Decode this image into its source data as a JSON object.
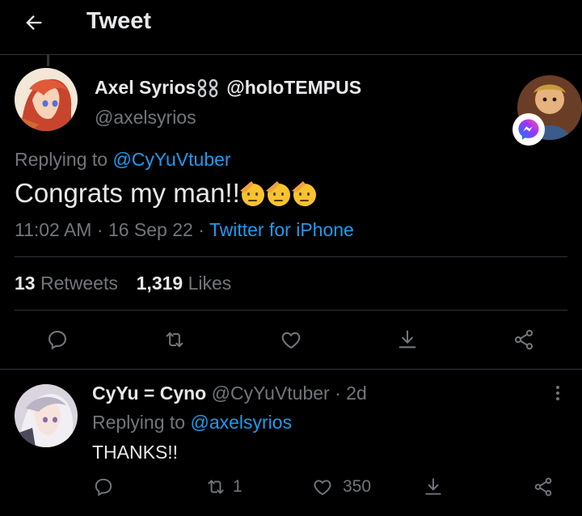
{
  "header": {
    "title": "Tweet",
    "back_icon": "arrow-left-icon"
  },
  "main_tweet": {
    "display_name": "Axel Syrios",
    "name_suffix_emoji": "chain-link-emoji",
    "secondary_handle": "@holoTEMPUS",
    "handle": "@axelsyrios",
    "replying_prefix": "Replying to",
    "replying_to": "@CyYuVtuber",
    "text": "Congrats my man!!",
    "emoji": [
      "saluting-face-emoji",
      "saluting-face-emoji",
      "saluting-face-emoji"
    ],
    "time": "11:02 AM",
    "sep": "·",
    "date": "16 Sep 22",
    "source": "Twitter for iPhone",
    "retweets_count": "13",
    "retweets_label": "Retweets",
    "likes_count": "1,319",
    "likes_label": "Likes",
    "actions": [
      "reply-icon",
      "retweet-icon",
      "like-icon",
      "bookmark-download-icon",
      "share-icon"
    ]
  },
  "reply": {
    "display_name": "CyYu = Cyno",
    "handle": "@CyYuVtuber",
    "sep": "·",
    "age": "2d",
    "replying_prefix": "Replying to",
    "replying_to": "@axelsyrios",
    "text": "THANKS!!",
    "retweet_count": "1",
    "like_count": "350"
  },
  "colors": {
    "background": "#000000",
    "link": "#1d9bf0",
    "muted": "#71767b",
    "text": "#e7e9ea",
    "divider": "#2f3336"
  }
}
